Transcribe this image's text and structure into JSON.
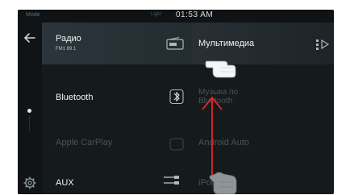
{
  "status": {
    "left": "Mode",
    "middle": "Light",
    "time": "01:53 AM"
  },
  "nav": {
    "back_icon": "back-arrow-icon",
    "settings_icon": "gear-icon"
  },
  "menu": {
    "radio": {
      "label": "Радио",
      "sub": "FM1 89.1",
      "icon": "radio-icon"
    },
    "multimedia": {
      "label": "Мультимедиа",
      "icon": "media-icon"
    },
    "bluetooth": {
      "label": "Bluetooth",
      "icon": "bluetooth-icon"
    },
    "bt_music": {
      "label": "Музыка по Bluetooth"
    },
    "carplay": {
      "label": "Apple CarPlay"
    },
    "android_auto": {
      "label": "Android Auto"
    },
    "aux": {
      "label": "AUX",
      "icon": "aux-icon"
    },
    "ipod": {
      "label": "iPod"
    }
  },
  "colors": {
    "screen_bg": "#151a1d",
    "arrow": "#e3262a"
  }
}
